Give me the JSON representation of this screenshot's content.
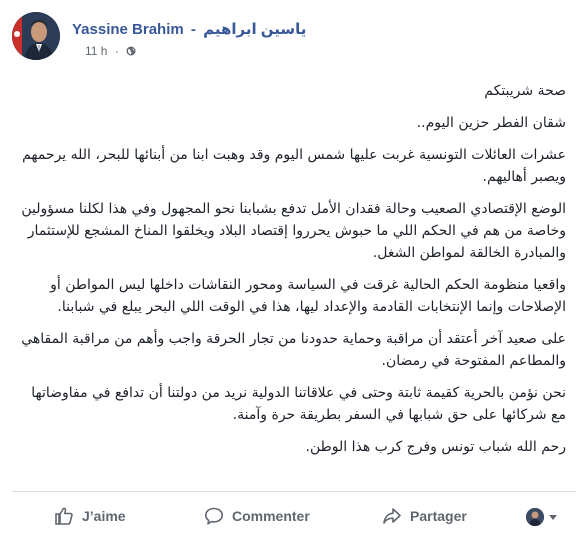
{
  "post": {
    "author_name": "Yassine Brahim",
    "separator": "-",
    "author_name_ar": "ياسين ابراهيم",
    "timestamp": "11 h",
    "meta_dot": "·",
    "privacy_icon": "globe-icon"
  },
  "content": {
    "paragraphs": [
      "صحة شريبتكم",
      "شقان الفطر حزين اليوم..",
      "عشرات العائلات التونسية غربت عليها شمس اليوم وقد وهبت ابنا من أبنائها للبحر، الله يرحمهم ويصبر أهاليهم.",
      "الوضع الإقتصادي الصعيب وحالة فقدان الأمل تدفع بشبابنا نحو المجهول وفي هذا لكلنا مسؤولين وخاصة من هم في الحكم اللي ما حبوش يحرروا إقتصاد البلاد ويخلقوا المناخ المشجع للإستثمار والمبادرة الخالقة لمواطن الشغل.",
      "واقعيا منظومة الحكم الحالية غرقت في السياسة ومحور النقاشات داخلها ليس المواطن أو الإصلاحات وإنما الإنتخابات القادمة والإعداد ليها، هذا في الوقت اللي البحر يبلع في شبابنا.",
      "على صعيد آخر أعتقد أن مراقبة وحماية حدودنا من تجار الحرقة واجب وأهم من مراقبة المقاهي والمطاعم المفتوحة في رمضان.",
      "نحن نؤمن بالحرية كقيمة ثابتة وحتى في علاقاتنا الدولية نريد من دولتنا أن تدافع في مفاوضاتها مع شركائها على حق شبابها في السفر بطريقة حرة وآمنة.",
      "رحم الله شباب تونس وفرج كرب هذا الوطن."
    ]
  },
  "actions": {
    "like_label": "J’aime",
    "comment_label": "Commenter",
    "share_label": "Partager"
  },
  "colors": {
    "author_link": "#385898",
    "muted": "#606770",
    "text": "#1d2129",
    "divider": "#dadde1"
  }
}
